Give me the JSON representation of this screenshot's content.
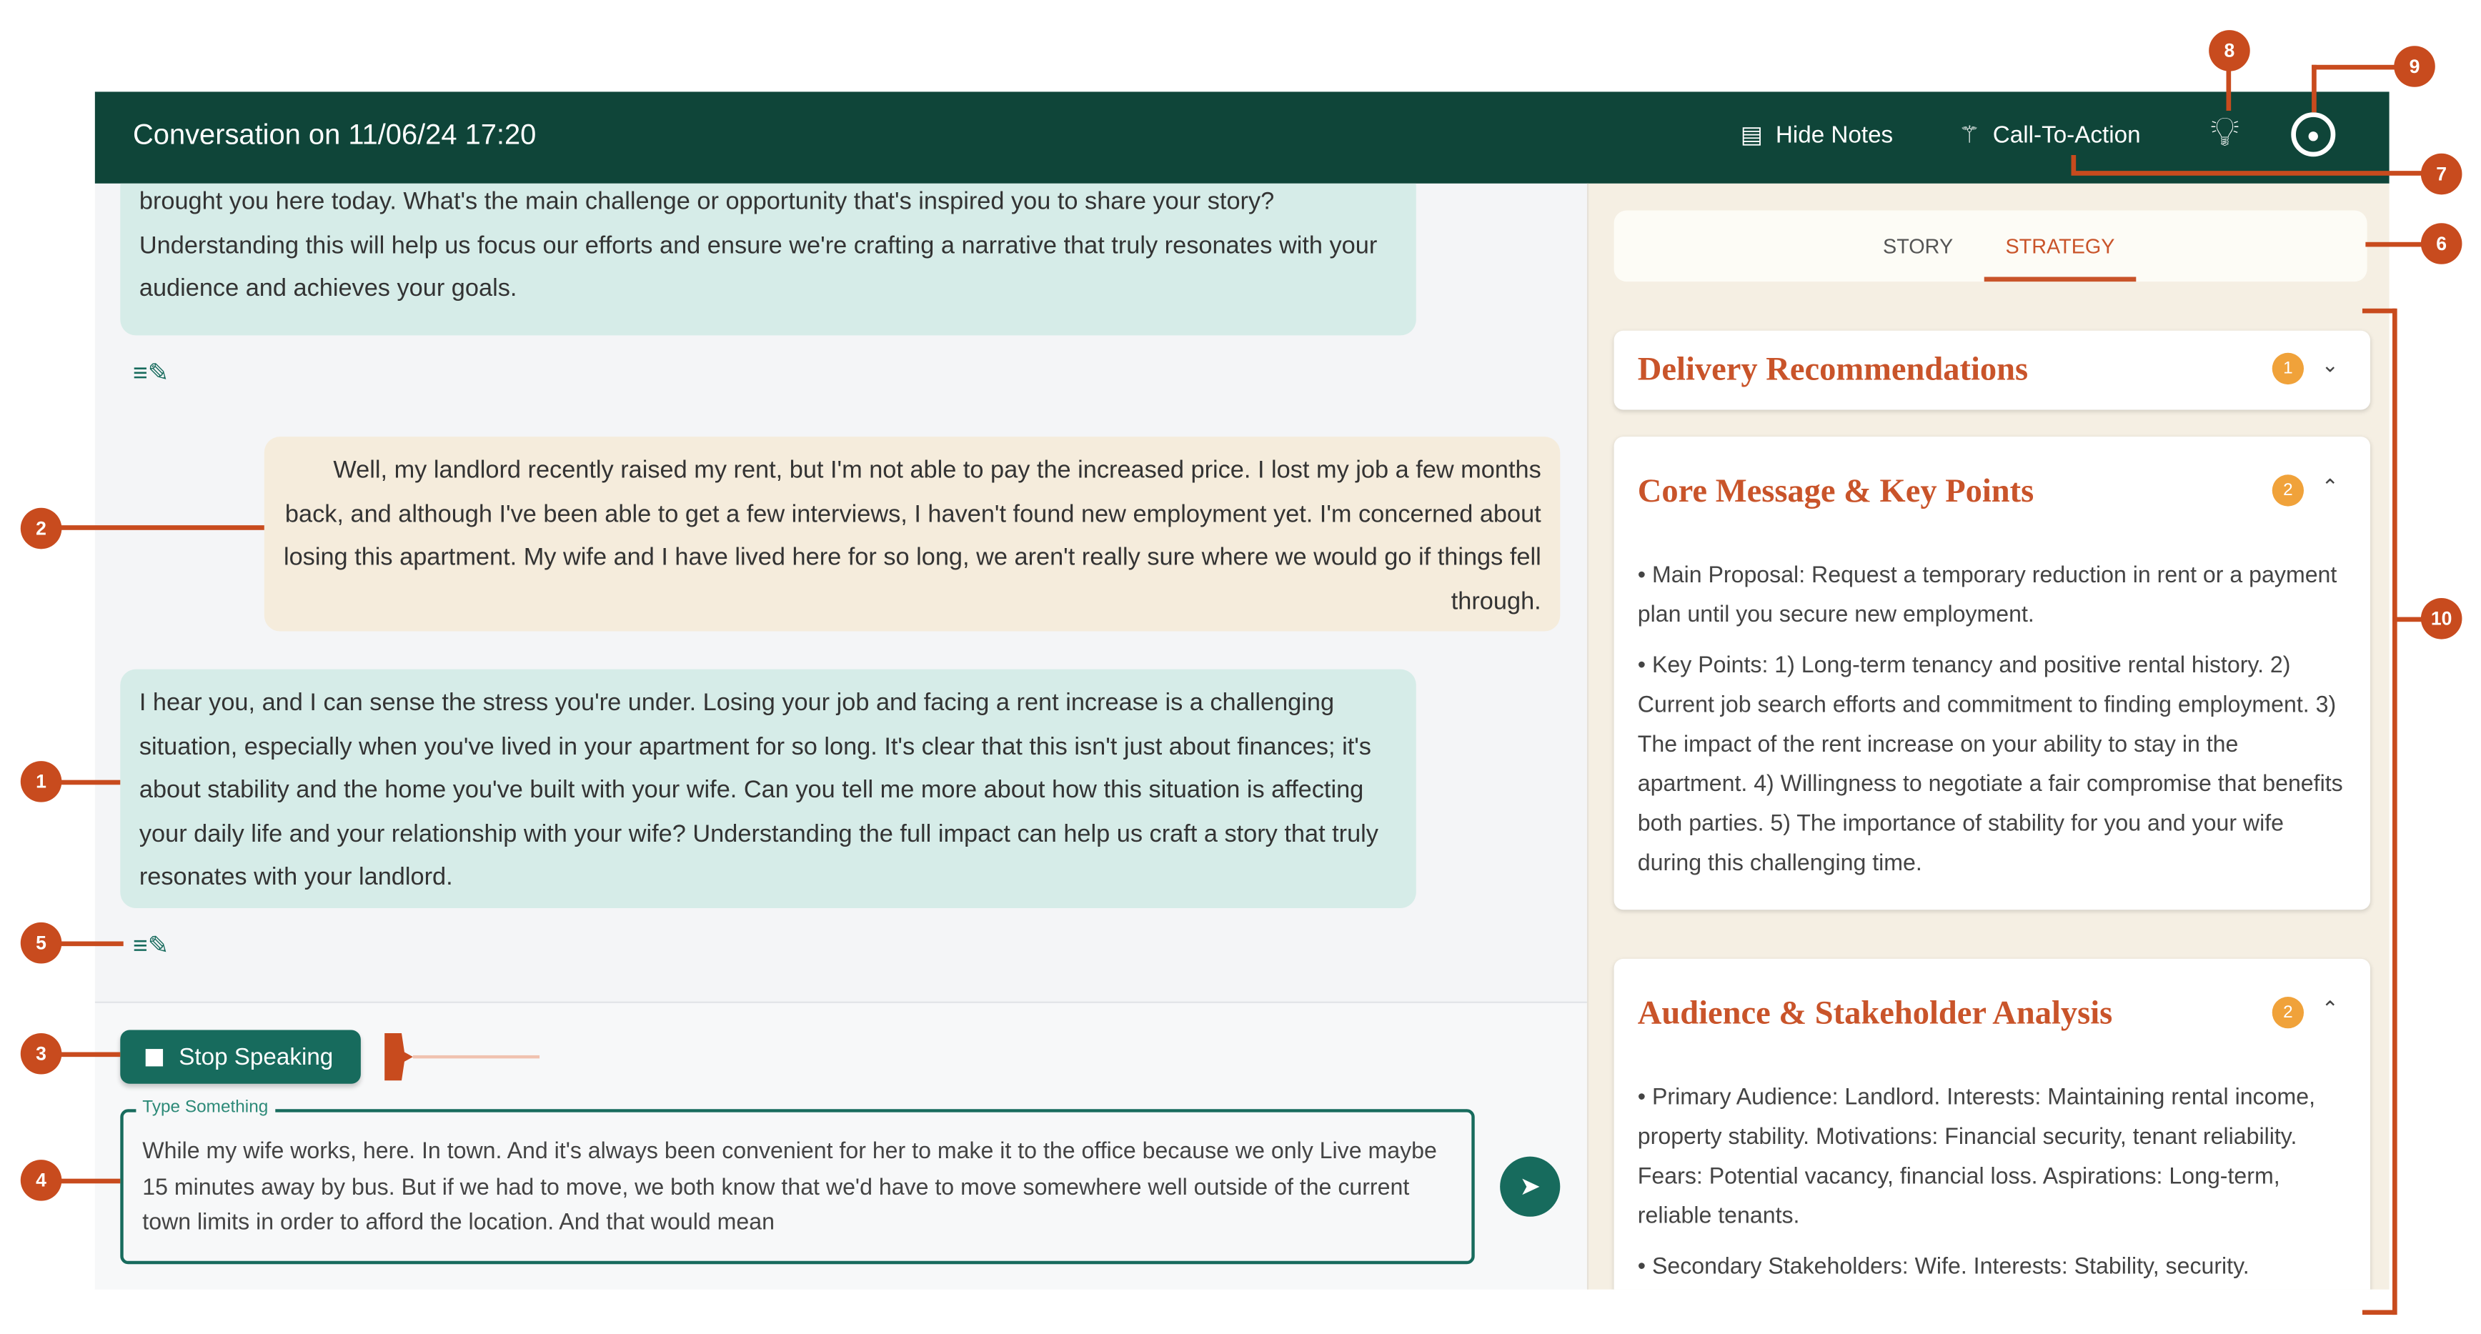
{
  "header": {
    "title": "Conversation on 11/06/24 17:20",
    "hide_notes": "Hide Notes",
    "call_to_action": "Call-To-Action"
  },
  "chat": {
    "messages": [
      {
        "role": "assistant",
        "text": "brought you here today. What's the main challenge or opportunity that's inspired you to share your story? Understanding this will help us focus our efforts and ensure we're crafting a narrative that truly resonates with your audience and achieves your goals."
      },
      {
        "role": "user",
        "text": "Well, my landlord recently raised my rent, but I'm not able to pay the increased price. I lost my job a few months back, and although I've been able to get a few interviews, I haven't found new employment yet. I'm concerned about losing this apartment. My wife and I have lived here for so long, we aren't really sure where we would go if things fell through."
      },
      {
        "role": "assistant",
        "text": "I hear you, and I can sense the stress you're under. Losing your job and facing a rent increase is a challenging situation, especially when you've lived in your apartment for so long. It's clear that this isn't just about finances; it's about stability and the home you've built with your wife. Can you tell me more about how this situation is affecting your daily life and your relationship with your wife? Understanding the full impact can help us craft a story that truly resonates with your landlord."
      }
    ],
    "stop_speaking": "Stop Speaking",
    "input_label": "Type Something",
    "input_value": "While my wife works, here. In town. And it's always been convenient for her to make it to the office because we only Live maybe 15 minutes away by bus. But if we had to move, we both know that we'd have to move somewhere well outside of the current town limits in order to afford the location. And that would mean"
  },
  "panel": {
    "tabs": [
      {
        "label": "STORY",
        "active": false
      },
      {
        "label": "STRATEGY",
        "active": true
      }
    ],
    "cards": [
      {
        "title": "Delivery Recommendations",
        "badge": "1",
        "expanded": false
      },
      {
        "title": "Core Message & Key Points",
        "badge": "2",
        "expanded": true,
        "items": [
          "• Main Proposal: Request a temporary reduction in rent or a payment plan until you secure new employment.",
          "• Key Points: 1) Long-term tenancy and positive rental history. 2) Current job search efforts and commitment to finding employment. 3) The impact of the rent increase on your ability to stay in the apartment. 4) Willingness to negotiate a fair compromise that benefits both parties. 5) The importance of stability for you and your wife during this challenging time."
        ]
      },
      {
        "title": "Audience & Stakeholder Analysis",
        "badge": "2",
        "expanded": true,
        "items": [
          "• Primary Audience: Landlord. Interests: Maintaining rental income, property stability. Motivations: Financial security, tenant reliability. Fears: Potential vacancy, financial loss. Aspirations: Long-term, reliable tenants.",
          "• Secondary Stakeholders: Wife. Interests: Stability, security."
        ]
      }
    ]
  },
  "annotations": [
    "1",
    "2",
    "3",
    "4",
    "5",
    "6",
    "7",
    "8",
    "9",
    "10"
  ],
  "colors": {
    "header": "#0f4539",
    "primary": "#176b5d",
    "accent": "#c9542a",
    "annotation": "#c84b1e"
  }
}
